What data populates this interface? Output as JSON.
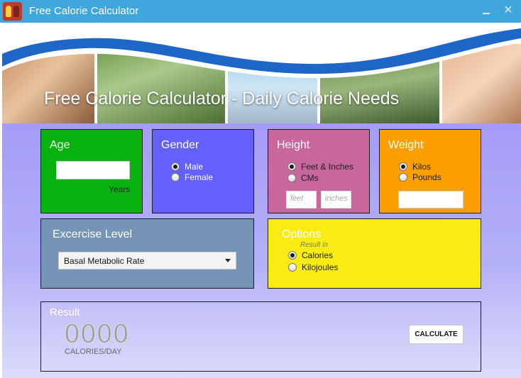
{
  "window": {
    "title": "Free Calorie Calculator",
    "minimize_label": "_",
    "close_label": "✕"
  },
  "banner": {
    "title": "Free Calorie Calculator - Daily Calorie Needs"
  },
  "age": {
    "title": "Age",
    "value": "",
    "unit": "Years"
  },
  "gender": {
    "title": "Gender",
    "options": [
      "Male",
      "Female"
    ],
    "selected": "Male"
  },
  "height": {
    "title": "Height",
    "options": [
      "Feet & Inches",
      "CMs"
    ],
    "selected": "Feet & Inches",
    "feet_placeholder": "feet",
    "inches_placeholder": "inches"
  },
  "weight": {
    "title": "Weight",
    "options": [
      "Kilos",
      "Pounds"
    ],
    "selected": "Kilos",
    "value": ""
  },
  "exercise": {
    "title": "Excercise Level",
    "selected": "Basal Metabolic Rate"
  },
  "options": {
    "title": "Options",
    "result_in_label": "Result in",
    "units": [
      "Calories",
      "Kilojoules"
    ],
    "selected": "Calories"
  },
  "result": {
    "title": "Result",
    "value": "0000",
    "unit": "CALORIES/DAY",
    "calculate_label": "CALCULATE"
  },
  "colors": {
    "titlebar": "#3fa7dc",
    "age_panel": "#08b20f",
    "gender_panel": "#6461fb",
    "height_panel": "#c8679c",
    "weight_panel": "#fd9f00",
    "exercise_panel": "#7694b6",
    "options_panel": "#f9ec13",
    "background": "#a49cf7"
  }
}
